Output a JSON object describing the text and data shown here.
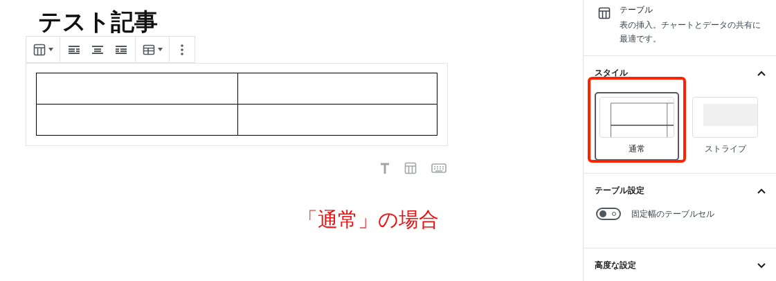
{
  "editor": {
    "title": "テスト記事"
  },
  "annotation": {
    "text": "「通常」の場合"
  },
  "sidebar": {
    "block": {
      "title": "テーブル",
      "description": "表の挿入。チャートとデータの共有に最適です。"
    },
    "panels": [
      {
        "title": "スタイル",
        "expanded": true,
        "kind": "styles",
        "options": [
          {
            "label": "通常",
            "kind": "regular",
            "selected": true,
            "highlighted": true
          },
          {
            "label": "ストライプ",
            "kind": "stripes",
            "selected": false,
            "highlighted": false
          }
        ]
      },
      {
        "title": "テーブル設定",
        "expanded": true,
        "kind": "settings",
        "toggles": [
          {
            "label": "固定幅のテーブルセル",
            "on": false
          }
        ]
      },
      {
        "title": "高度な設定",
        "expanded": false
      }
    ]
  }
}
